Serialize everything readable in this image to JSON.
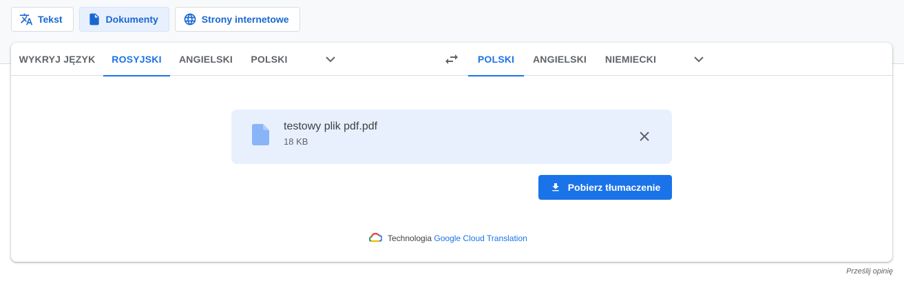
{
  "mode_tabs": [
    {
      "label": "Tekst",
      "icon": "translate-icon",
      "active": false
    },
    {
      "label": "Dokumenty",
      "icon": "document-icon",
      "active": true
    },
    {
      "label": "Strony internetowe",
      "icon": "globe-icon",
      "active": false
    }
  ],
  "source_languages": [
    "WYKRYJ JĘZYK",
    "ROSYJSKI",
    "ANGIELSKI",
    "POLSKI"
  ],
  "source_active": "ROSYJSKI",
  "target_languages": [
    "POLSKI",
    "ANGIELSKI",
    "NIEMIECKI"
  ],
  "target_active": "POLSKI",
  "icons": {
    "more_source": "chevron-down-icon",
    "swap": "swap-icon",
    "more_target": "chevron-down-icon"
  },
  "file": {
    "name": "testowy plik pdf.pdf",
    "size": "18 KB",
    "icon": "file-icon",
    "remove_icon": "close-icon"
  },
  "download_label": "Pobierz tłumaczenie",
  "attribution": {
    "prefix": "Technologia",
    "link": "Google Cloud Translation"
  },
  "feedback_label": "Prześlij opinię",
  "colors": {
    "accent": "#1a73e8",
    "file_bg": "#e8f0fe",
    "file_icon": "#8ab4f8"
  }
}
